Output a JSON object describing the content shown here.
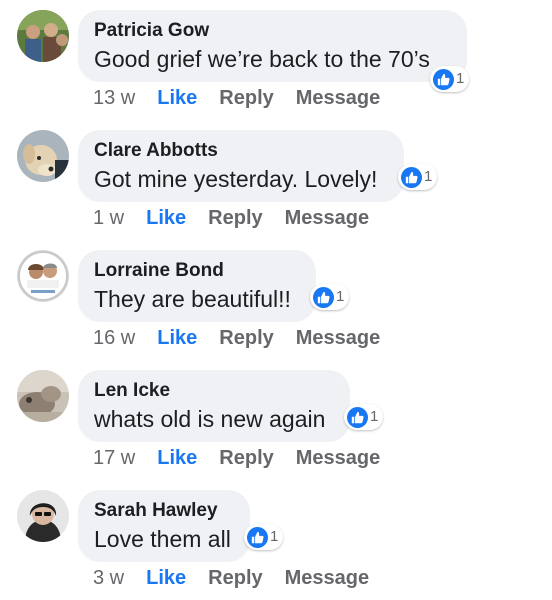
{
  "colors": {
    "like_blue": "#1877f2",
    "bubble_bg": "#eff1f4",
    "meta_gray": "#65676b"
  },
  "comments": [
    {
      "author": "Patricia Gow",
      "text": "Good grief we’re back to the 70’s",
      "time": "13 w",
      "like_label": "Like",
      "reply_label": "Reply",
      "message_label": "Message",
      "reaction_icon": "thumbs-up-icon",
      "reaction_count": "1"
    },
    {
      "author": "Clare Abbotts",
      "text": "Got mine yesterday. Lovely!",
      "time": "1 w",
      "like_label": "Like",
      "reply_label": "Reply",
      "message_label": "Message",
      "reaction_icon": "thumbs-up-icon",
      "reaction_count": "1"
    },
    {
      "author": "Lorraine Bond",
      "text": "They are beautiful!!",
      "time": "16 w",
      "like_label": "Like",
      "reply_label": "Reply",
      "message_label": "Message",
      "reaction_icon": "thumbs-up-icon",
      "reaction_count": "1"
    },
    {
      "author": "Len Icke",
      "text": "whats old is new again",
      "time": "17 w",
      "like_label": "Like",
      "reply_label": "Reply",
      "message_label": "Message",
      "reaction_icon": "thumbs-up-icon",
      "reaction_count": "1"
    },
    {
      "author": "Sarah Hawley",
      "text": "Love them all",
      "time": "3 w",
      "like_label": "Like",
      "reply_label": "Reply",
      "message_label": "Message",
      "reaction_icon": "thumbs-up-icon",
      "reaction_count": "1"
    }
  ]
}
